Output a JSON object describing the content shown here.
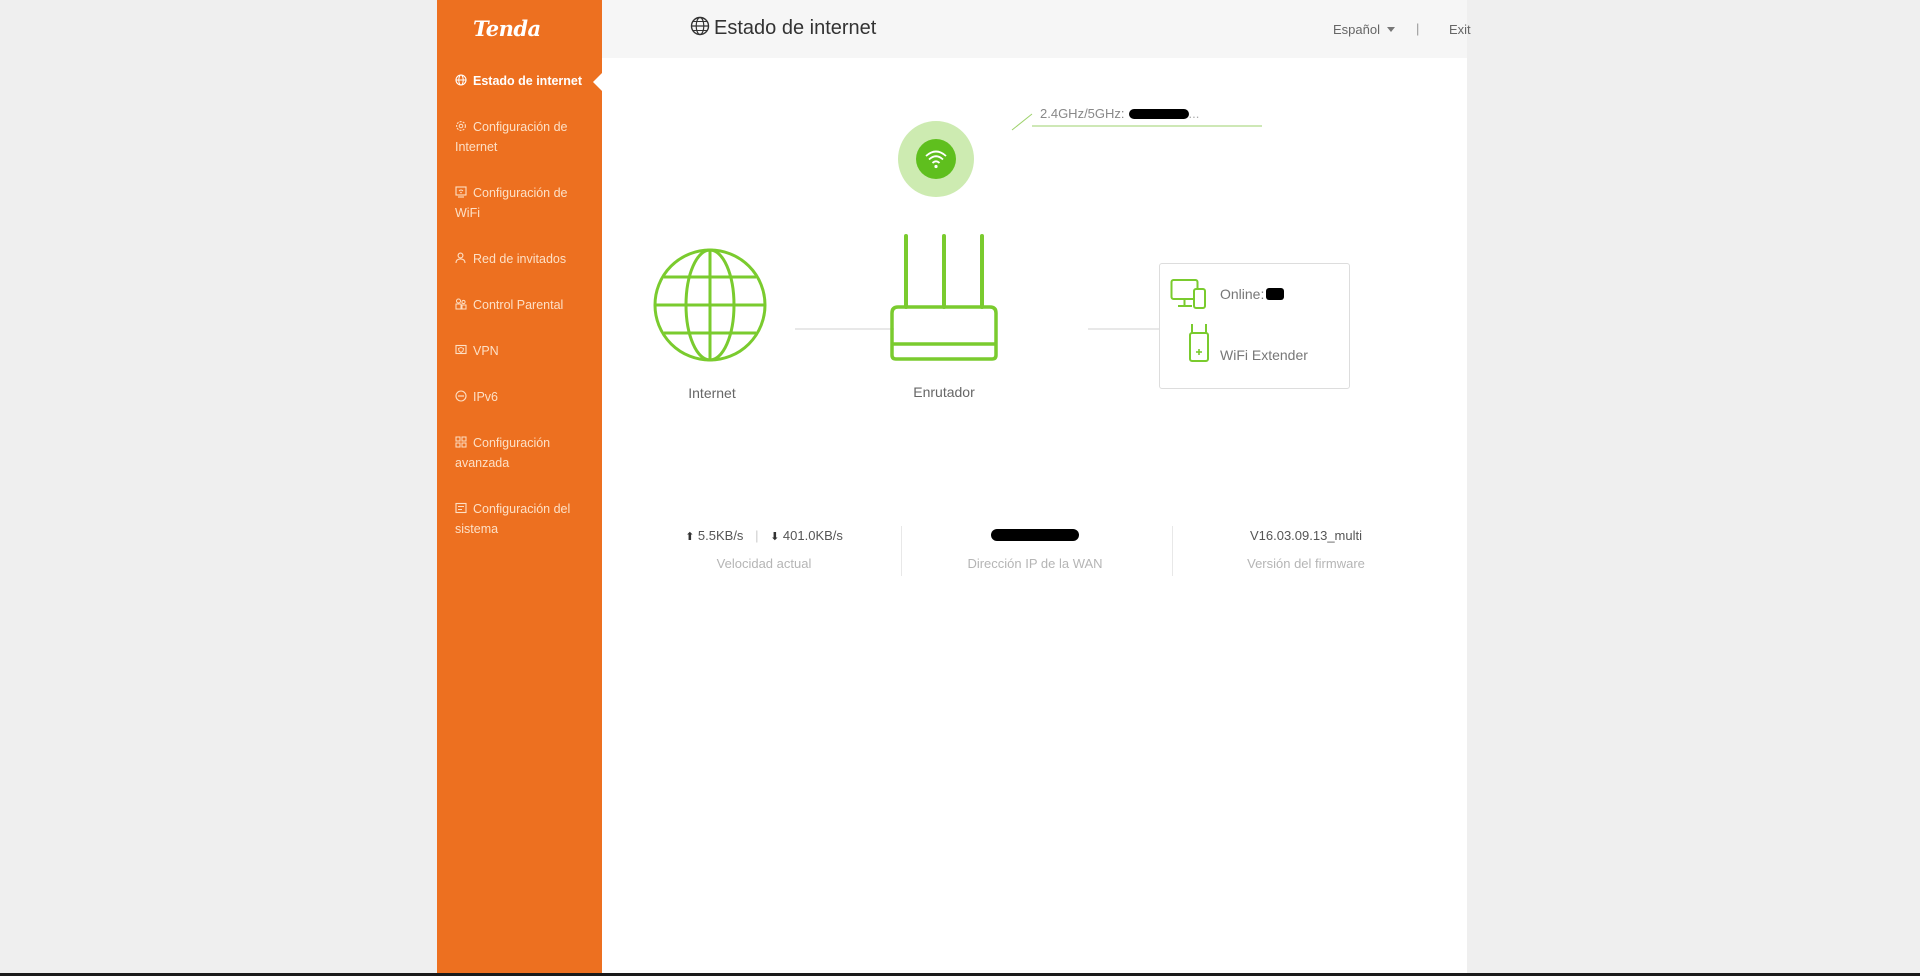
{
  "brand": {
    "logo": "Tenda",
    "accent_color": "#ed7020",
    "green_color": "#6fcd2b"
  },
  "sidebar": {
    "items": [
      {
        "id": "internet-status",
        "label": "Estado de internet",
        "active": true,
        "icon": "globe-icon"
      },
      {
        "id": "internet-config",
        "label": "Configuración de Internet",
        "active": false,
        "icon": "gear-icon"
      },
      {
        "id": "wifi-config",
        "label": "Configuración de WiFi",
        "active": false,
        "icon": "wifi-settings-icon"
      },
      {
        "id": "guest-network",
        "label": "Red de invitados",
        "active": false,
        "icon": "guest-user-icon"
      },
      {
        "id": "parental-control",
        "label": "Control Parental",
        "active": false,
        "icon": "parental-icon"
      },
      {
        "id": "vpn",
        "label": "VPN",
        "active": false,
        "icon": "shield-icon"
      },
      {
        "id": "ipv6",
        "label": "IPv6",
        "active": false,
        "icon": "ipv6-icon"
      },
      {
        "id": "advanced",
        "label": "Configuración avanzada",
        "active": false,
        "icon": "grid-icon"
      },
      {
        "id": "system",
        "label": "Configuración del sistema",
        "active": false,
        "icon": "system-icon"
      }
    ]
  },
  "header": {
    "title": "Estado de internet",
    "language": "Español",
    "separator": "|",
    "exit": "Exit"
  },
  "topology": {
    "wifi_label": "2.4GHz/5GHz:",
    "wifi_ellipsis": "...",
    "internet_label": "Internet",
    "router_label": "Enrutador",
    "devices": {
      "online_label": "Online:",
      "extender_label": "WiFi Extender"
    }
  },
  "stats": {
    "upload": "5.5KB/s",
    "download": "401.0KB/s",
    "speed_label": "Velocidad actual",
    "wan_label": "Dirección IP de la WAN",
    "firmware": "V16.03.09.13_multi",
    "firmware_label": "Versión del firmware"
  }
}
